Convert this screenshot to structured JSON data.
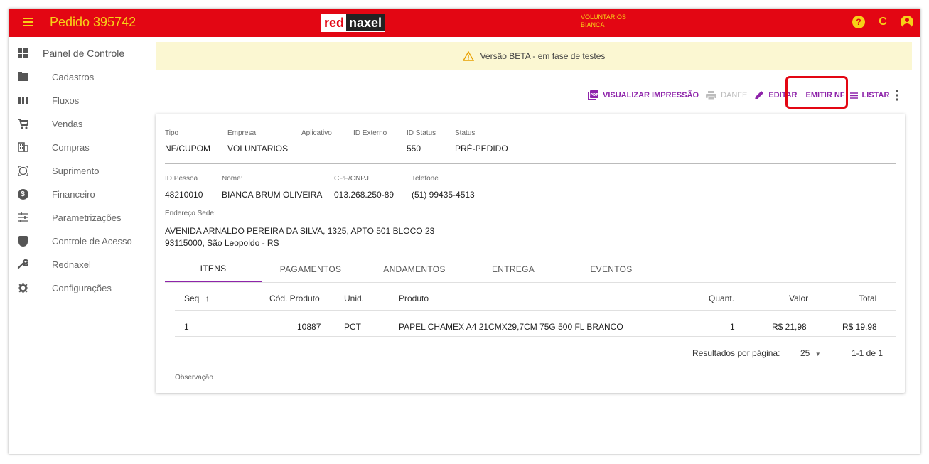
{
  "app": {
    "title": "Pedido 395742",
    "logo_red": "red",
    "logo_rest": "naxel",
    "user_company": "VOLUNTARIOS",
    "user_name": "BIANCA",
    "colors": {
      "topbar": "#e30613",
      "accent_yellow": "#f7d117",
      "primary": "#8e24aa",
      "beta_bg": "#fbf7d2"
    }
  },
  "sidebar": {
    "items": [
      {
        "label": "Painel de Controle",
        "icon": "dashboard-icon"
      },
      {
        "label": "Cadastros",
        "icon": "folder-icon"
      },
      {
        "label": "Fluxos",
        "icon": "columns-icon"
      },
      {
        "label": "Vendas",
        "icon": "cart-icon"
      },
      {
        "label": "Compras",
        "icon": "building-icon"
      },
      {
        "label": "Suprimento",
        "icon": "target-icon"
      },
      {
        "label": "Financeiro",
        "icon": "dollar-icon"
      },
      {
        "label": "Parametrizações",
        "icon": "tune-icon"
      },
      {
        "label": "Controle de Acesso",
        "icon": "shield-icon"
      },
      {
        "label": "Rednaxel",
        "icon": "wrench-icon"
      },
      {
        "label": "Configurações",
        "icon": "gear-icon"
      }
    ]
  },
  "banner": {
    "text": "Versão BETA - em fase de testes"
  },
  "toolbar": {
    "print_preview": "VISUALIZAR IMPRESSÃO",
    "danfe": "DANFE",
    "edit": "EDITAR",
    "emit_nf": "EMITIR NF",
    "list": "LISTAR"
  },
  "order": {
    "labels": {
      "tipo": "Tipo",
      "empresa": "Empresa",
      "aplicativo": "Aplicativo",
      "id_externo": "ID Externo",
      "id_status": "ID Status",
      "status": "Status",
      "id_pessoa": "ID Pessoa",
      "nome": "Nome:",
      "cpf": "CPF/CNPJ",
      "telefone": "Telefone",
      "endereco": "Endereço Sede:"
    },
    "tipo": "NF/CUPOM",
    "empresa": "VOLUNTARIOS",
    "aplicativo": "",
    "id_externo": "",
    "id_status": "550",
    "status": "PRÉ-PEDIDO",
    "id_pessoa": "48210010",
    "nome": "BIANCA BRUM OLIVEIRA",
    "cpf": "013.268.250-89",
    "telefone": "(51) 99435-4513",
    "endereco_line1": "AVENIDA ARNALDO PEREIRA DA SILVA, 1325, APTO 501 BLOCO 23",
    "endereco_line2": "93115000, São Leopoldo - RS"
  },
  "tabs": [
    "ITENS",
    "PAGAMENTOS",
    "ANDAMENTOS",
    "ENTREGA",
    "EVENTOS"
  ],
  "table": {
    "headers": {
      "seq": "Seq",
      "cod": "Cód. Produto",
      "unid": "Unid.",
      "produto": "Produto",
      "quant": "Quant.",
      "valor": "Valor",
      "total": "Total"
    },
    "rows": [
      {
        "seq": "1",
        "cod": "10887",
        "unid": "PCT",
        "produto": "PAPEL CHAMEX A4 21CMX29,7CM 75G 500 FL BRANCO",
        "quant": "1",
        "valor": "R$ 21,98",
        "total": "R$ 19,98"
      }
    ]
  },
  "pager": {
    "label": "Resultados por página:",
    "per_page": "25",
    "range": "1-1 de 1"
  },
  "observacao": "Observação"
}
